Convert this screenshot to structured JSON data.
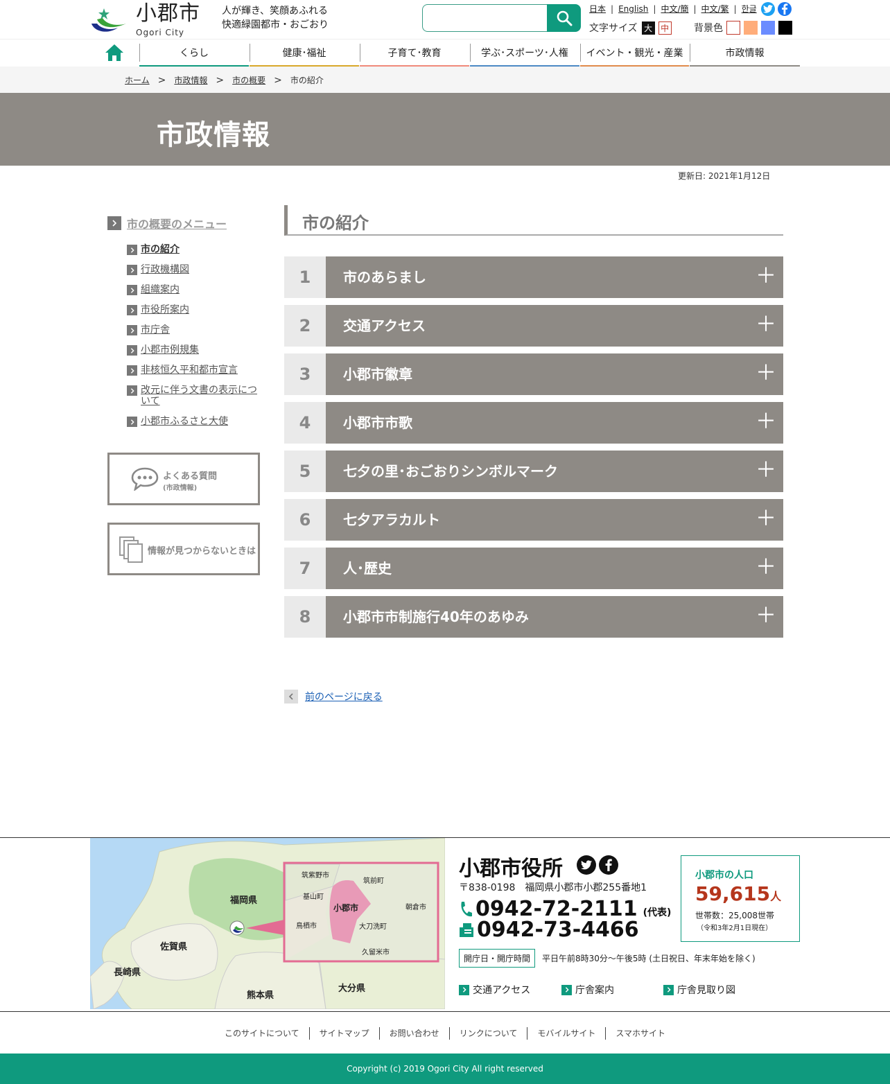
{
  "header": {
    "logo_name": "小郡市",
    "logo_en": "Ogori City",
    "slogan_line1": "人が輝き、笑顔あふれる",
    "slogan_line2": "快適緑園都市・おごおり",
    "search_placeholder": "",
    "languages": [
      "日本",
      "English",
      "中文/簡",
      "中文/繁",
      "한글"
    ],
    "font_size_label": "文字サイズ",
    "font_size_big": "大",
    "font_size_mid": "中",
    "bg_label": "背景色",
    "bg_colors": [
      "#ffffff",
      "#ffad7a",
      "#6b8cff",
      "#000000"
    ]
  },
  "nav": {
    "items": [
      {
        "label": "くらし",
        "color": "#0f9a7e"
      },
      {
        "label": "健康･福祉",
        "color": "#d9a829"
      },
      {
        "label": "子育て･教育",
        "color": "#f0897a"
      },
      {
        "label": "学ぶ･スポーツ･人権",
        "color": "#4c89c4"
      },
      {
        "label": "イベント・観光・産業",
        "color": "#e08a4b"
      },
      {
        "label": "市政情報",
        "color": "#8e8a85"
      }
    ]
  },
  "breadcrumb": {
    "items": [
      "ホーム",
      "市政情報",
      "市の概要"
    ],
    "current": "市の紹介"
  },
  "page": {
    "category_title": "市政情報",
    "updated": "更新日: 2021年1月12日",
    "section_title": "市の紹介"
  },
  "sidebar": {
    "heading": "市の概要のメニュー",
    "items": [
      "市の紹介",
      "行政機構図",
      "組織案内",
      "市役所案内",
      "市庁舎",
      "小郡市例規集",
      "非核恒久平和都市宣言",
      "改元に伴う文書の表示について",
      "小郡市ふるさと大使"
    ],
    "faq_title": "よくある質問",
    "faq_sub": "(市政情報)",
    "notfound": "情報が見つからないときは"
  },
  "accordion": [
    {
      "num": "1",
      "label": "市のあらまし"
    },
    {
      "num": "2",
      "label": "交通アクセス"
    },
    {
      "num": "3",
      "label": "小郡市徽章"
    },
    {
      "num": "4",
      "label": "小郡市市歌"
    },
    {
      "num": "5",
      "label": "七夕の里･おごおりシンボルマーク"
    },
    {
      "num": "6",
      "label": "七夕アラカルト"
    },
    {
      "num": "7",
      "label": "人･歴史"
    },
    {
      "num": "8",
      "label": "小郡市市制施行40年のあゆみ"
    }
  ],
  "accordion_plus": "＋",
  "back_link": "前のページに戻る",
  "footer": {
    "map_labels": {
      "fukuoka": "福岡県",
      "saga": "佐賀県",
      "nagasaki": "長崎県",
      "kumamoto": "熊本県",
      "oita": "大分県",
      "chikushino": "筑紫野市",
      "chikuzen": "筑前町",
      "kiyama": "基山町",
      "ogori": "小郡市",
      "asakura": "朝倉市",
      "tosu": "鳥栖市",
      "tachiarai": "大刀洗町",
      "kurume": "久留米市"
    },
    "office_name": "小郡市役所",
    "address": "〒838-0198　福岡県小郡市小郡255番地1",
    "tel": "0942-72-2111",
    "tel_note": "(代表)",
    "fax": "0942-73-4466",
    "hours_badge": "開庁日・開庁時間",
    "hours_text": "平日午前8時30分～午後5時 (土日祝日、年末年始を除く)",
    "links": [
      "交通アクセス",
      "庁舎案内",
      "庁舎見取り図"
    ],
    "population_label": "小郡市の人口",
    "population_value": "59,615",
    "population_unit": "人",
    "households": "世帯数：25,008世帯",
    "population_asof": "（令和3年2月1日現在）",
    "util_links": [
      "このサイトについて",
      "サイトマップ",
      "お問い合わせ",
      "リンクについて",
      "モバイルサイト",
      "スマホサイト"
    ],
    "copyright": "Copyright (c) 2019 Ogori City All right reserved"
  }
}
